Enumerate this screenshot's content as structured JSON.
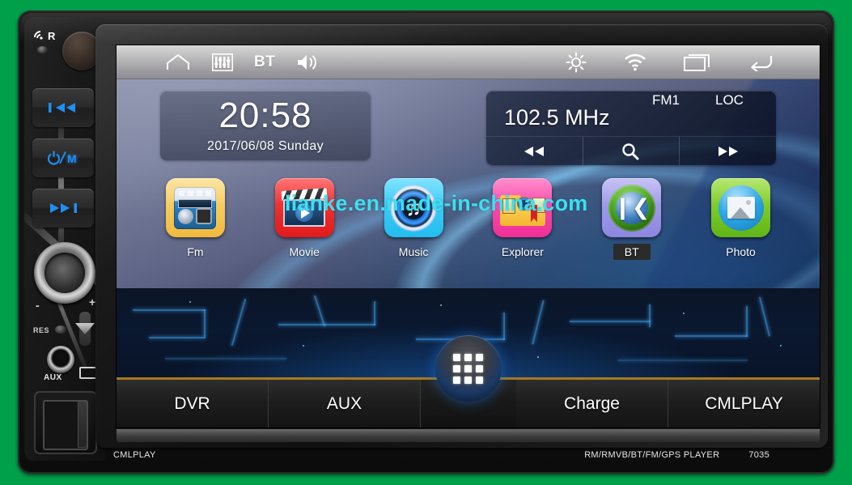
{
  "device": {
    "brand_left": "CMLPLAY",
    "brand_model_text": "RM/RMVB/BT/FM/GPS PLAYER",
    "brand_model_number": "7035",
    "accent_green": "#00a04a",
    "body_color": "#111111"
  },
  "left_panel": {
    "ir_label": "R",
    "ir_icon": "ir-sensor-icon",
    "reset_dot": "reset-hole-icon",
    "top_knob": "rotary-knob",
    "keys": [
      {
        "name": "previous-track-button",
        "label": "⏮◀◀",
        "glyph": "prev"
      },
      {
        "name": "power-mode-button",
        "label": "⏻/M",
        "glyph": "power"
      },
      {
        "name": "next-track-button",
        "label": "▶▶⏭",
        "glyph": "next"
      }
    ],
    "volume_knob": "volume-knob",
    "minus_label": "-",
    "plus_label": "+",
    "res_label": "RES",
    "aux_label": "AUX",
    "usb_port": "usb-port-icon",
    "mic": "microphone-icon",
    "card_slot": "sd-card-slot"
  },
  "statusbar": {
    "left_items": [
      {
        "name": "home-icon",
        "label": "home"
      },
      {
        "name": "equalizer-icon",
        "label": "eq"
      },
      {
        "name": "bluetooth-label",
        "label": "BT"
      },
      {
        "name": "volume-icon",
        "label": "volume"
      }
    ],
    "right_items": [
      {
        "name": "brightness-icon",
        "label": "brightness"
      },
      {
        "name": "wifi-icon",
        "label": "wifi"
      },
      {
        "name": "recents-icon",
        "label": "recents"
      },
      {
        "name": "back-icon",
        "label": "back"
      }
    ]
  },
  "clock_widget": {
    "time": "20:58",
    "date": "2017/06/08  Sunday"
  },
  "radio_widget": {
    "frequency": "102.5  MHz",
    "band": "FM1",
    "local_mode": "LOC",
    "buttons": [
      {
        "name": "radio-seek-down-button",
        "icon": "rewind-icon"
      },
      {
        "name": "radio-scan-button",
        "icon": "search-icon"
      },
      {
        "name": "radio-seek-up-button",
        "icon": "fast-forward-icon"
      }
    ]
  },
  "apps": [
    {
      "name": "app-fm",
      "label": "Fm",
      "color": "#f7ce5b",
      "selected": false,
      "icon": "radio-icon"
    },
    {
      "name": "app-movie",
      "label": "Movie",
      "color": "#f02929",
      "selected": false,
      "icon": "movie-icon"
    },
    {
      "name": "app-music",
      "label": "Music",
      "color": "#35c8ef",
      "selected": false,
      "icon": "music-icon"
    },
    {
      "name": "app-explorer",
      "label": "Explorer",
      "color": "#f54aa8",
      "selected": false,
      "icon": "folder-icon"
    },
    {
      "name": "app-bt",
      "label": "BT",
      "color": "#9a95e8",
      "selected": true,
      "icon": "bluetooth-icon"
    },
    {
      "name": "app-photo",
      "label": "Photo",
      "color": "#76c824",
      "selected": false,
      "icon": "photo-icon"
    }
  ],
  "watermark": {
    "text": "lianke.en.made-in-china.com",
    "color": "#3ce0f0"
  },
  "bottom_bar": {
    "left_buttons": [
      {
        "name": "dvr-button",
        "label": "DVR"
      },
      {
        "name": "aux-button",
        "label": "AUX"
      }
    ],
    "right_buttons": [
      {
        "name": "charge-button",
        "label": "Charge"
      },
      {
        "name": "cmlplay-button",
        "label": "CMLPLAY"
      }
    ],
    "app_grid_button": "app-drawer-button"
  }
}
